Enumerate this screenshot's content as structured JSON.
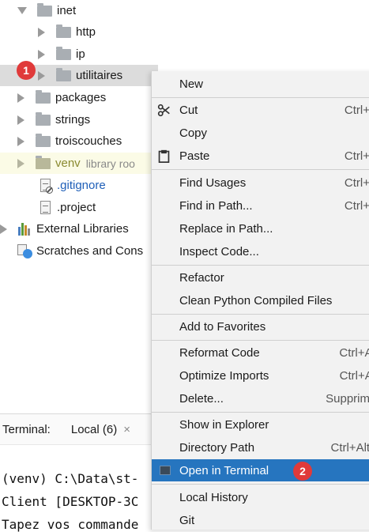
{
  "tree": {
    "inet": "inet",
    "http": "http",
    "ip": "ip",
    "utilitaires": "utilitaires",
    "packages": "packages",
    "strings": "strings",
    "troiscouches": "troiscouches",
    "venv": "venv",
    "venv_sub": "library roo",
    "gitignore": ".gitignore",
    "project": ".project",
    "external_libraries": "External Libraries",
    "scratches": "Scratches and Cons"
  },
  "badges": {
    "step1": "1",
    "step2": "2"
  },
  "terminal": {
    "title": "Terminal:",
    "tab": "Local (6)",
    "close": "×",
    "line1": "(venv) C:\\Data\\st-",
    "line2": "Client [DESKTOP-3C",
    "line3": "Tapez vos commande"
  },
  "menu": {
    "items": [
      {
        "label": "New",
        "shortcut": ""
      },
      {
        "label": "Cut",
        "shortcut": "Ctrl+"
      },
      {
        "label": "Copy",
        "shortcut": ""
      },
      {
        "label": "Paste",
        "shortcut": "Ctrl+"
      },
      {
        "label": "Find Usages",
        "shortcut": "Ctrl+"
      },
      {
        "label": "Find in Path...",
        "shortcut": "Ctrl+"
      },
      {
        "label": "Replace in Path...",
        "shortcut": ""
      },
      {
        "label": "Inspect Code...",
        "shortcut": ""
      },
      {
        "label": "Refactor",
        "shortcut": ""
      },
      {
        "label": "Clean Python Compiled Files",
        "shortcut": ""
      },
      {
        "label": "Add to Favorites",
        "shortcut": ""
      },
      {
        "label": "Reformat Code",
        "shortcut": "Ctrl+Alt-"
      },
      {
        "label": "Optimize Imports",
        "shortcut": "Ctrl+Alt+"
      },
      {
        "label": "Delete...",
        "shortcut": "Supprim"
      },
      {
        "label": "Show in Explorer",
        "shortcut": ""
      },
      {
        "label": "Directory Path",
        "shortcut": "Ctrl+Alt+F"
      },
      {
        "label": "Open in Terminal",
        "shortcut": ""
      },
      {
        "label": "Local History",
        "shortcut": ""
      },
      {
        "label": "Git",
        "shortcut": ""
      }
    ]
  },
  "colors": {
    "highlight": "#2675bf",
    "badge": "#e03a3a",
    "folder": "#a9aeb3"
  }
}
